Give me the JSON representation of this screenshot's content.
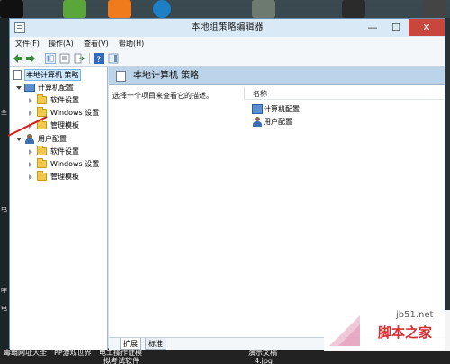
{
  "window": {
    "title": "本地组策略编辑器",
    "minimize": "—",
    "maximize": "☐",
    "close": "✕"
  },
  "menu": [
    "文件(F)",
    "操作(A)",
    "查看(V)",
    "帮助(H)"
  ],
  "tree": {
    "root": "本地计算机 策略",
    "computer_config": "计算机配置",
    "computer_children": [
      "软件设置",
      "Windows 设置",
      "管理模板"
    ],
    "user_config": "用户配置",
    "user_children": [
      "软件设置",
      "Windows 设置",
      "管理模板"
    ]
  },
  "right_pane": {
    "header": "本地计算机 策略",
    "description": "选择一个项目来查看它的描述。",
    "column_name": "名称",
    "items": [
      "计算机配置",
      "用户配置"
    ],
    "tabs": [
      "扩展",
      "标准"
    ]
  },
  "taskbar": {
    "items": [
      "毒霸网址大全",
      "PP游戏世界",
      "电工操作证模",
      "拟考试软件",
      "演示文稿",
      "4.jpg"
    ],
    "left_edge": [
      "全",
      "电",
      "咋",
      "电"
    ]
  },
  "watermark": {
    "url": "jb51.net",
    "brand": "脚本之家"
  },
  "colors": {
    "accent": "#cce8ff",
    "close_button": "#c9463d",
    "folder": "#f3c94b",
    "annotation_line": "#d61e1e"
  }
}
